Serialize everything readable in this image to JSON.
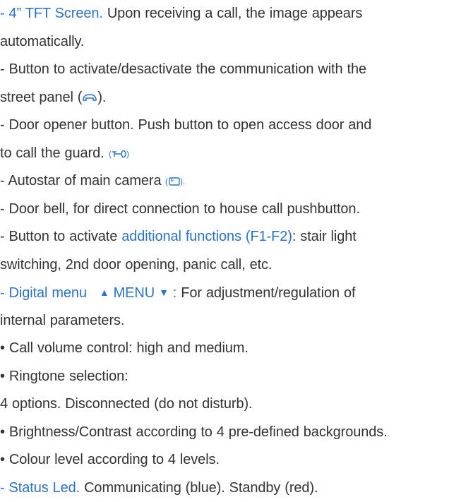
{
  "items": {
    "screen": {
      "lead": "- 4” TFT Screen.",
      "rest_line1": "Upon receiving a call, the image appears",
      "rest_line2": "automatically."
    },
    "comm_button": {
      "line1": "- Button to activate/desactivate the communication with the",
      "line2_prefix": "street panel (",
      "line2_suffix": ").",
      "icon": "handset-icon"
    },
    "door_opener": {
      "line1": "- Door opener button. Push button to open access door and",
      "line2_prefix": "to call the guard.",
      "icon": "key-icon"
    },
    "autostar": {
      "prefix": "- Autostar of main camera",
      "icon": "camera-icon"
    },
    "door_bell": {
      "text": "- Door bell, for direct connection to house call pushbutton."
    },
    "functions": {
      "line1_prefix": "- Button to activate",
      "line1_link": "additional functions (F1-F2)",
      "line1_suffix": ": stair light",
      "line2": "switching, 2nd door opening, panic call, etc."
    },
    "digital_menu": {
      "lead": "- Digital menu",
      "menu_word": "MENU",
      "colon": ":",
      "line1_rest": "For adjustment/regulation of",
      "line2": "internal parameters."
    },
    "bullets": [
      "• Call volume control: high and medium.",
      "• Ringtone selection:",
      "4 options. Disconnected (do not disturb).",
      "• Brightness/Contrast according to 4 pre-defined backgrounds.",
      "• Colour level according to 4 levels."
    ],
    "status_led": {
      "lead": "- Status Led.",
      "rest": "Communicating (blue). Standby (red)."
    }
  },
  "colors": {
    "text": "#333333",
    "accent": "#2a73c6"
  }
}
